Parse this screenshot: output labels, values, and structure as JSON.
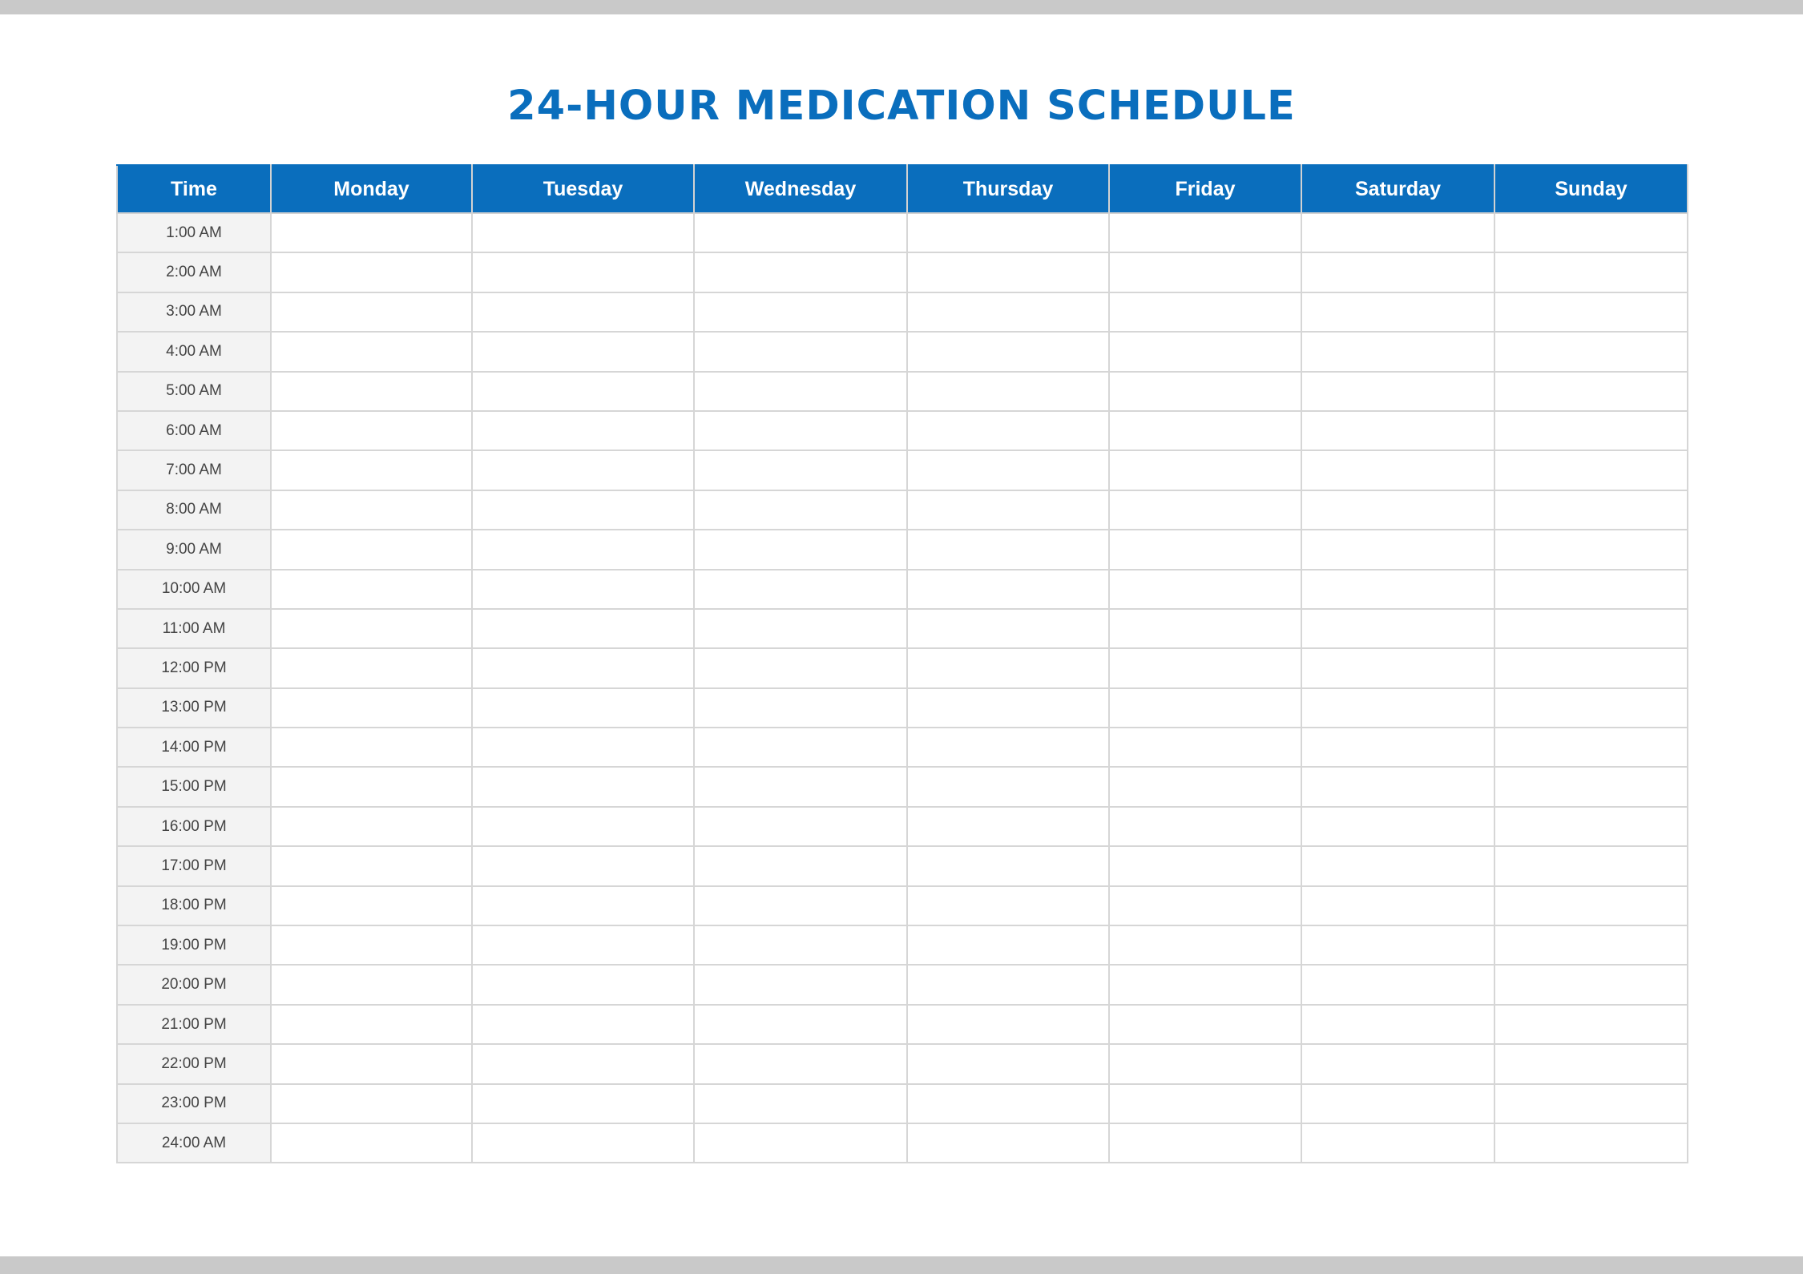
{
  "title": "24-HOUR MEDICATION SCHEDULE",
  "colors": {
    "accent": "#0a6ebd",
    "time_column_bg": "#f3f3f3",
    "grid": "#d6d6d6"
  },
  "columns": [
    "Time",
    "Monday",
    "Tuesday",
    "Wednesday",
    "Thursday",
    "Friday",
    "Saturday",
    "Sunday"
  ],
  "times": [
    "1:00 AM",
    "2:00 AM",
    "3:00 AM",
    "4:00 AM",
    "5:00 AM",
    "6:00 AM",
    "7:00 AM",
    "8:00 AM",
    "9:00 AM",
    "10:00 AM",
    "11:00 AM",
    "12:00 PM",
    "13:00 PM",
    "14:00 PM",
    "15:00 PM",
    "16:00 PM",
    "17:00 PM",
    "18:00 PM",
    "19:00 PM",
    "20:00 PM",
    "21:00 PM",
    "22:00 PM",
    "23:00 PM",
    "24:00 AM"
  ]
}
